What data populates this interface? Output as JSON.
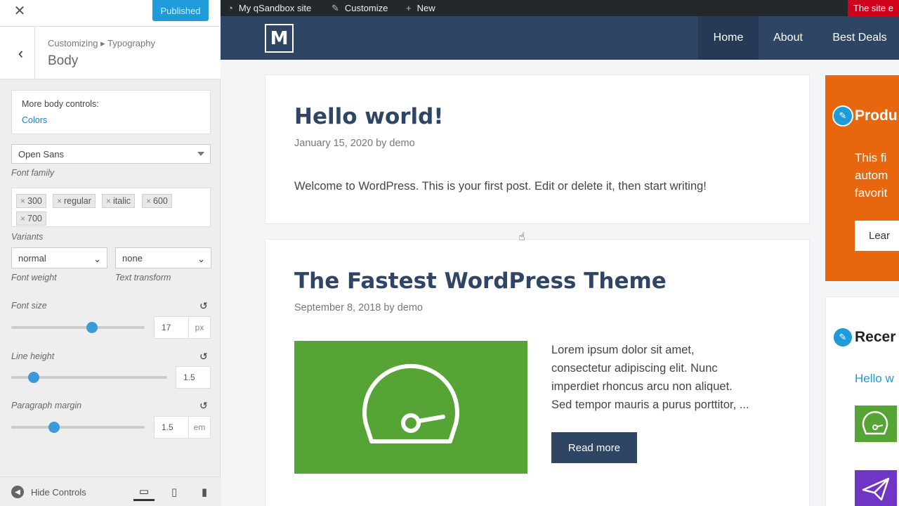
{
  "customizer": {
    "close_icon": "close-icon",
    "publish_label": "Published",
    "breadcrumb": "Customizing ▸ Typography",
    "section_title": "Body",
    "more_controls_label": "More body controls:",
    "more_controls_link": "Colors",
    "font_family": {
      "value": "Open Sans",
      "caption": "Font family"
    },
    "variants": {
      "caption": "Variants",
      "chips": [
        "300",
        "regular",
        "italic",
        "600",
        "700"
      ]
    },
    "font_weight": {
      "value": "normal",
      "caption": "Font weight"
    },
    "text_transform": {
      "value": "none",
      "caption": "Text transform"
    },
    "font_size": {
      "label": "Font size",
      "value": "17",
      "unit": "px",
      "slider_fraction": 0.6
    },
    "line_height": {
      "label": "Line height",
      "value": "1.5",
      "slider_fraction": 0.14
    },
    "paragraph_margin": {
      "label": "Paragraph margin",
      "value": "1.5",
      "unit": "em",
      "slider_fraction": 0.32
    },
    "hide_controls_label": "Hide Controls",
    "devices": [
      "desktop-icon",
      "tablet-icon",
      "mobile-icon"
    ]
  },
  "adminbar": {
    "site_name": "My qSandbox site",
    "customize": "Customize",
    "new": "New",
    "warning": "The site e"
  },
  "site": {
    "logo_letter": "M",
    "nav": [
      "Home",
      "About",
      "Best Deals"
    ]
  },
  "posts": [
    {
      "title": "Hello world!",
      "meta": "January 15, 2020 by demo",
      "excerpt": "Welcome to WordPress. This is your first post. Edit or delete it, then start writing!"
    },
    {
      "title": "The Fastest WordPress Theme",
      "meta": "September 8, 2018 by demo",
      "excerpt_lines": [
        "Lorem ipsum dolor sit amet,",
        "consectetur adipiscing elit. Nunc",
        "imperdiet rhoncus arcu non aliquet.",
        "Sed tempor mauris a purus porttitor, ..."
      ],
      "button": "Read more"
    }
  ],
  "sidebar_widgets": {
    "product_title": "Produ",
    "product_text": [
      "This fi",
      "autom",
      "favorit"
    ],
    "product_button": "Lear",
    "recent_title": "Recer",
    "recent_link": "Hello w"
  },
  "colors": {
    "nav": "#2e4563",
    "accent": "#1e9bd8",
    "orange": "#e8670e",
    "green": "#56a435"
  }
}
